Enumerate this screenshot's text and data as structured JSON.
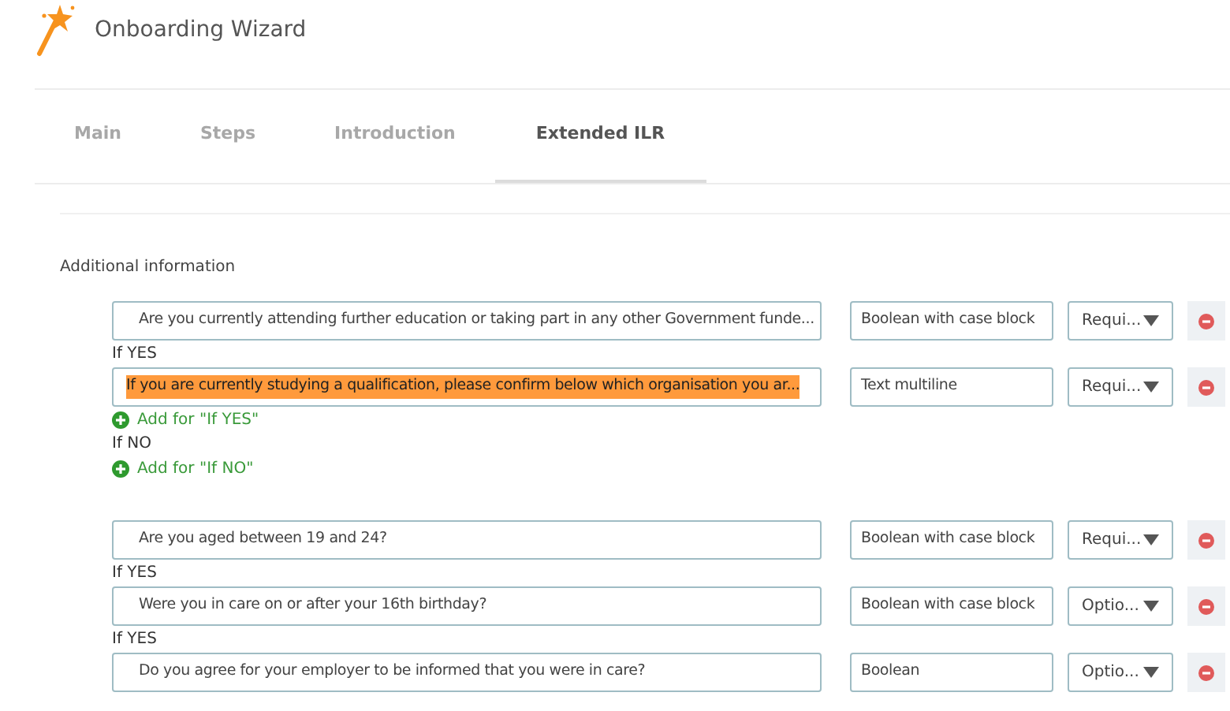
{
  "header": {
    "title": "Onboarding Wizard"
  },
  "tabs": [
    {
      "label": "Main",
      "selected": false
    },
    {
      "label": "Steps",
      "selected": false
    },
    {
      "label": "Introduction",
      "selected": false
    },
    {
      "label": "Extended ILR",
      "selected": true
    }
  ],
  "section": {
    "title": "Additional information"
  },
  "groups": [
    {
      "items": [
        {
          "kind": "question",
          "text": "Are you currently attending further education or taking part in any other Government funde...",
          "highlighted": false,
          "type": "Boolean with case block",
          "requirement": "Requi..."
        },
        {
          "kind": "label",
          "text": "If YES"
        },
        {
          "kind": "question",
          "text": "If you are currently studying a qualification, please confirm below which organisation you ar...",
          "highlighted": true,
          "type": "Text multiline",
          "requirement": "Requi..."
        },
        {
          "kind": "add",
          "text": "Add for \"If YES\""
        },
        {
          "kind": "label",
          "text": "If NO"
        },
        {
          "kind": "add",
          "text": "Add for \"If NO\""
        }
      ]
    },
    {
      "items": [
        {
          "kind": "question",
          "text": "Are you aged between 19 and 24?",
          "highlighted": false,
          "type": "Boolean with case block",
          "requirement": "Requi..."
        },
        {
          "kind": "label",
          "text": "If YES"
        },
        {
          "kind": "question",
          "text": "Were you in care on or after your 16th birthday?",
          "highlighted": false,
          "type": "Boolean with case block",
          "requirement": "Optio..."
        },
        {
          "kind": "label",
          "text": "If YES"
        },
        {
          "kind": "question",
          "text": "Do you agree for your employer to be informed that you were in care?",
          "highlighted": false,
          "type": "Boolean",
          "requirement": "Optio..."
        }
      ]
    }
  ]
}
